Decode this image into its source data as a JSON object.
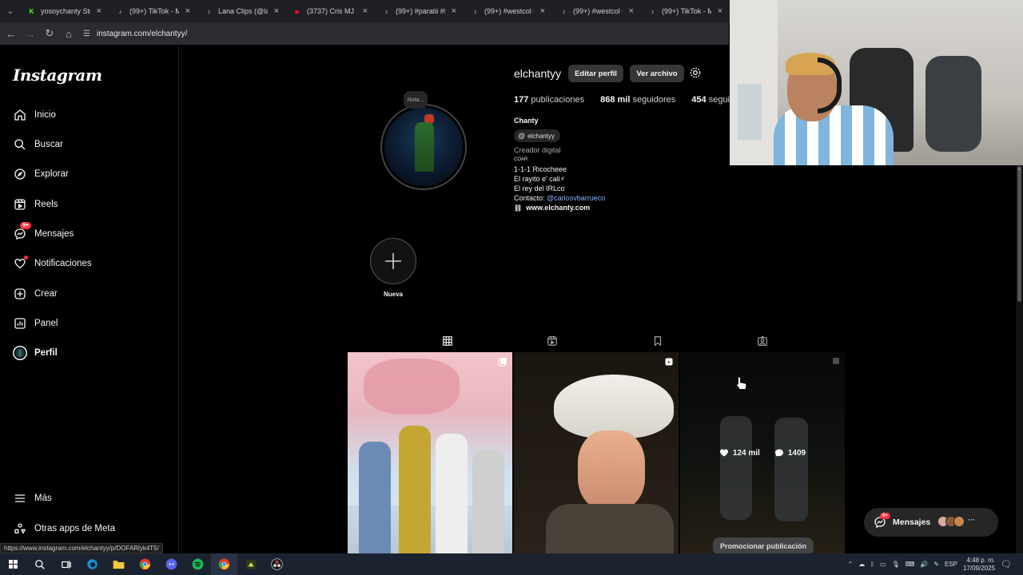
{
  "browser": {
    "tabs": [
      {
        "title": "yosoychanty Stre",
        "fav": "K",
        "fav_color": "#53fc18"
      },
      {
        "title": "(99+) TikTok - Ma",
        "fav": "♪",
        "fav_color": "#ffffff"
      },
      {
        "title": "Lana Clips (@lana",
        "fav": "♪",
        "fav_color": "#ffffff"
      },
      {
        "title": "(3737) Cris MJ - C",
        "fav": "▶",
        "fav_color": "#ff0033"
      },
      {
        "title": "(99+) #paratii #fyp",
        "fav": "♪",
        "fav_color": "#ffffff"
      },
      {
        "title": "(99+) #westcol #e",
        "fav": "♪",
        "fav_color": "#ffffff"
      },
      {
        "title": "(99+) #westcol #k",
        "fav": "♪",
        "fav_color": "#ffffff"
      },
      {
        "title": "(99+) TikTok - Ma",
        "fav": "♪",
        "fav_color": "#ffffff"
      }
    ],
    "url": "instagram.com/elchantyy/",
    "status_url": "https://www.instagram.com/elchantyy/p/DOFARlyk4T5/"
  },
  "sidebar": {
    "logo": "Instagram",
    "items": [
      {
        "label": "Inicio",
        "icon": "home-icon"
      },
      {
        "label": "Buscar",
        "icon": "search-icon"
      },
      {
        "label": "Explorar",
        "icon": "compass-icon"
      },
      {
        "label": "Reels",
        "icon": "reels-icon"
      },
      {
        "label": "Mensajes",
        "icon": "messenger-icon",
        "badge": "9+"
      },
      {
        "label": "Notificaciones",
        "icon": "heart-icon"
      },
      {
        "label": "Crear",
        "icon": "plus-square-icon"
      },
      {
        "label": "Panel",
        "icon": "chart-icon"
      },
      {
        "label": "Perfil",
        "icon": "avatar-icon"
      }
    ],
    "more": "Más",
    "meta_apps": "Otras apps de Meta"
  },
  "profile": {
    "username": "elchantyy",
    "edit_button": "Editar perfil",
    "archive_button": "Ver archivo",
    "note": "Nota...",
    "posts_count": "177",
    "posts_label": "publicaciones",
    "followers_count": "868 mil",
    "followers_label": "seguidores",
    "following_count": "454",
    "following_label": "seguidos",
    "name": "Chanty",
    "threads_handle": "elchantyy",
    "category": "Creador digital",
    "bio_coar": "COAR",
    "bio_line1": "1-1-1 Ricocheee",
    "bio_line2": "El rayito e' cali⚡",
    "bio_line3": "El rey del IRLco",
    "contact_label": "Contacto:",
    "contact_mention": "@carlosvbarrueco",
    "website": "www.elchanty.com"
  },
  "highlights": {
    "new_label": "Nueva"
  },
  "post3": {
    "likes": "124 mil",
    "comments": "1409",
    "promote": "Promocionar publicación"
  },
  "floating_messages": {
    "label": "Mensajes",
    "badge": "9+"
  },
  "taskbar": {
    "lang": "ESP",
    "time": "4:48 p. m.",
    "date": "17/09/2025"
  },
  "colors": {
    "accent_link": "#8ab4ff",
    "badge": "#ff3040"
  }
}
